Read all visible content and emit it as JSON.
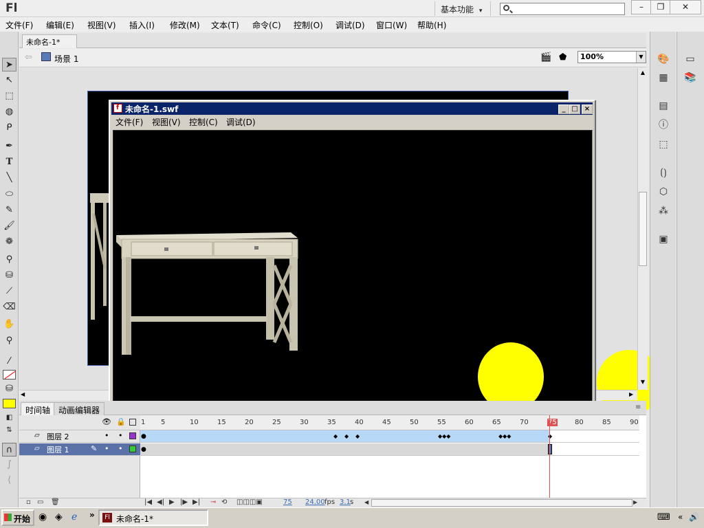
{
  "app": {
    "logo": "Fl",
    "workspace": "基本功能",
    "workspace_arrow": "▾"
  },
  "window_controls": {
    "minimize": "–",
    "restore": "❐",
    "close": "✕"
  },
  "menubar": [
    "文件(F)",
    "编辑(E)",
    "视图(V)",
    "插入(I)",
    "修改(M)",
    "文本(T)",
    "命令(C)",
    "控制(O)",
    "调试(D)",
    "窗口(W)",
    "帮助(H)"
  ],
  "document": {
    "tab_label": "未命名-1*",
    "tab_close": "×",
    "scene_label": "场景 1",
    "zoom": "100%"
  },
  "swf_window": {
    "title": "未命名-1.swf",
    "menu": [
      "文件(F)",
      "视图(V)",
      "控制(C)",
      "调试(D)"
    ],
    "ball_color": "#ffff00"
  },
  "timeline": {
    "tabs": [
      "时间轴",
      "动画编辑器"
    ],
    "ruler_ticks": [
      "1",
      "5",
      "10",
      "15",
      "20",
      "25",
      "30",
      "35",
      "40",
      "45",
      "50",
      "55",
      "60",
      "65",
      "70",
      "75",
      "80",
      "85",
      "90"
    ],
    "layers": [
      {
        "name": "图层 2",
        "color": "#9933cc"
      },
      {
        "name": "图层 1",
        "color": "#33cc33"
      }
    ],
    "current_frame": "75",
    "fps": "24.00",
    "fps_unit": "fps",
    "time": "3.1",
    "time_unit": "s"
  },
  "taskbar": {
    "start": "开始",
    "task": "未命名-1*",
    "more": "»"
  },
  "colors": {
    "stroke_swatch": "#ff0000",
    "fill_swatch": "#ffff00",
    "playhead": "#e05050",
    "tween_span": "#b8d8f8"
  }
}
